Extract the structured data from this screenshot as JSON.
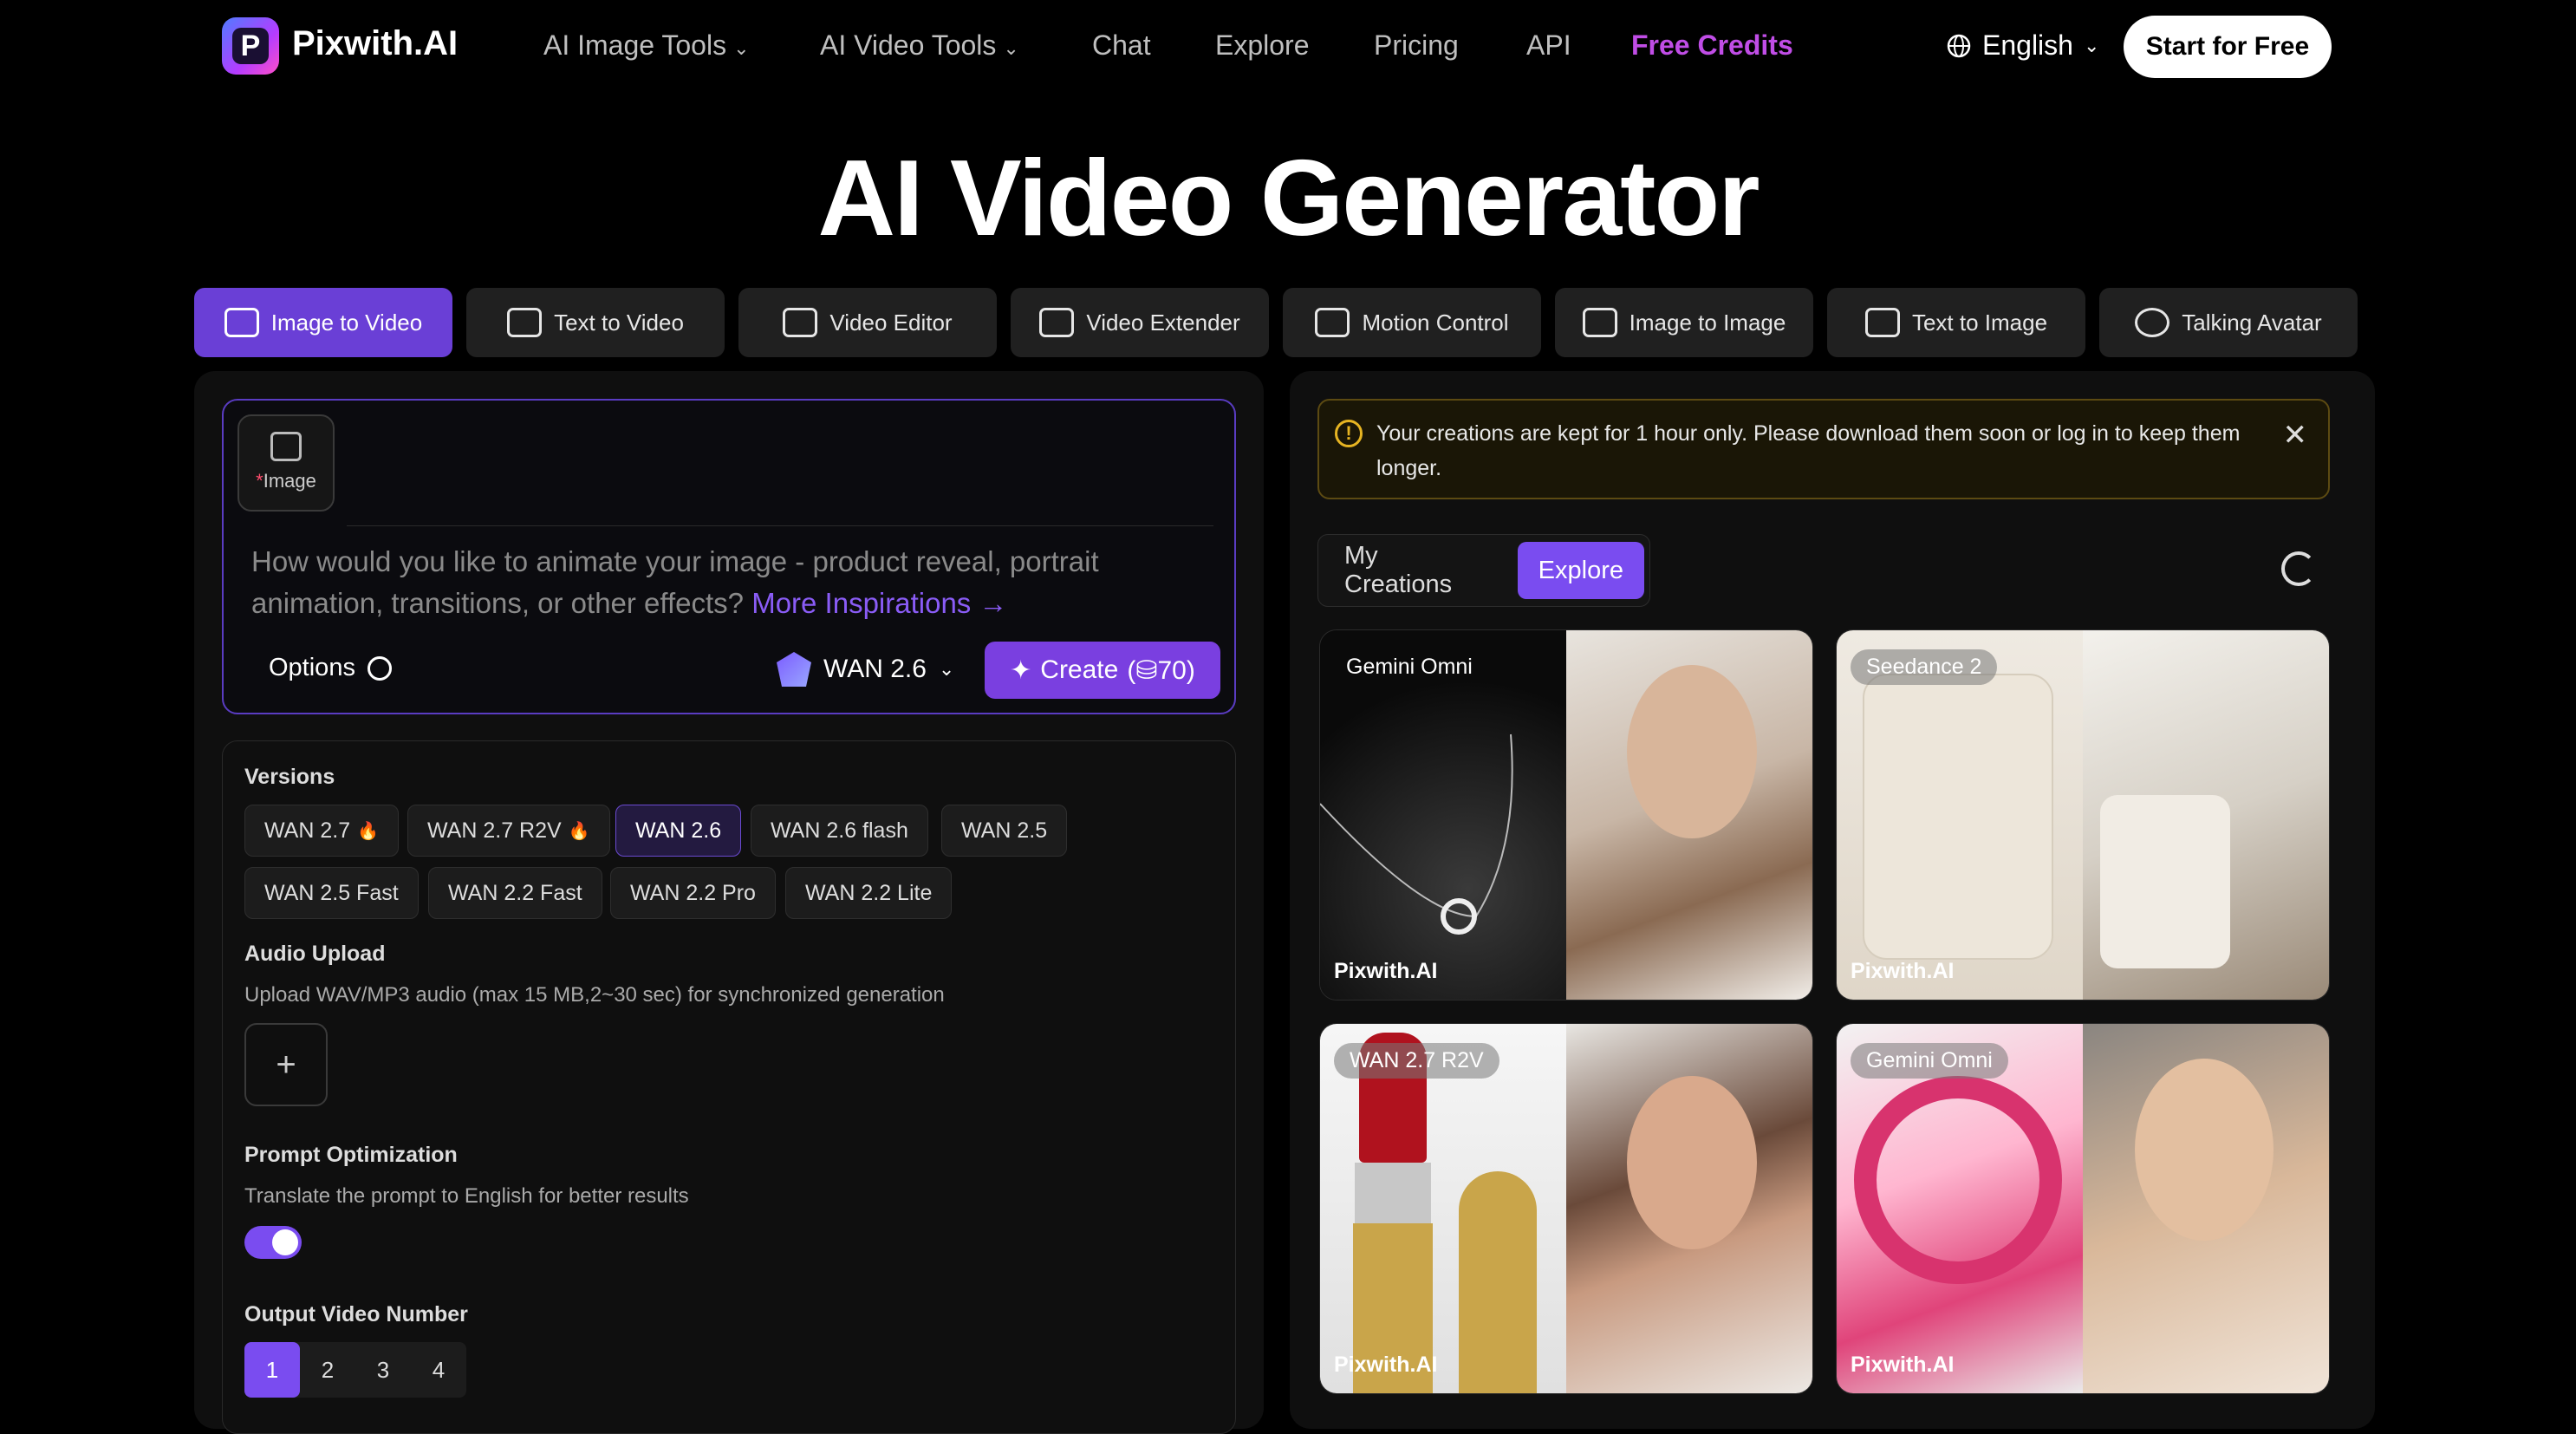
{
  "brand": {
    "logo_letter": "P",
    "name": "Pixwith.AI"
  },
  "nav": {
    "items": [
      "AI Image Tools",
      "AI Video Tools",
      "Chat",
      "Explore",
      "Pricing",
      "API",
      "Free Credits"
    ],
    "chevron": "⌄",
    "language": "English",
    "start_label": "Start for Free"
  },
  "hero": {
    "title": "AI Video Generator"
  },
  "tabs": [
    "Image to Video",
    "Text to Video",
    "Video Editor",
    "Video Extender",
    "Motion Control",
    "Image to Image",
    "Text to Image",
    "Talking Avatar"
  ],
  "prompt": {
    "image_label": "Image",
    "required_mark": "*",
    "placeholder": "How would you like to animate your image - product reveal, portrait animation, transitions, or other effects?",
    "inspirations_link": "More Inspirations →",
    "options_label": "Options",
    "model": "WAN 2.6",
    "create_label": "Create",
    "create_cost": "70"
  },
  "settings": {
    "versions_title": "Versions",
    "versions": [
      {
        "label": "WAN 2.7",
        "hot": true
      },
      {
        "label": "WAN 2.7 R2V",
        "hot": true
      },
      {
        "label": "WAN 2.6",
        "hot": false,
        "selected": true
      },
      {
        "label": "WAN 2.6 flash",
        "hot": false
      },
      {
        "label": "WAN 2.5",
        "hot": false
      },
      {
        "label": "WAN 2.5 Fast",
        "hot": false
      },
      {
        "label": "WAN 2.2 Fast",
        "hot": false
      },
      {
        "label": "WAN 2.2 Pro",
        "hot": false
      },
      {
        "label": "WAN 2.2 Lite",
        "hot": false
      }
    ],
    "audio_title": "Audio Upload",
    "audio_desc": "Upload WAV/MP3 audio (max 15 MB,2~30 sec) for synchronized generation",
    "opt_title": "Prompt Optimization",
    "opt_desc": "Translate the prompt to English for better results",
    "opt_enabled": true,
    "output_title": "Output Video Number",
    "output_numbers": [
      "1",
      "2",
      "3",
      "4"
    ],
    "output_selected": "1"
  },
  "notice": {
    "text": "Your creations are kept for 1 hour only. Please download them soon or log in to keep them longer."
  },
  "gallery": {
    "tabs": [
      "My Creations",
      "Explore"
    ],
    "active_tab": "Explore",
    "cards": [
      {
        "model": "Gemini Omni",
        "watermark": "Pixwith.AI"
      },
      {
        "model": "Seedance 2",
        "watermark": "Pixwith.AI"
      },
      {
        "model": "WAN 2.7 R2V",
        "watermark": "Pixwith.AI"
      },
      {
        "model": "Gemini Omni",
        "watermark": "Pixwith.AI"
      }
    ]
  },
  "colors": {
    "accent": "#7a4cf0",
    "free_credits": "#c04de6",
    "warning": "#e6b422"
  }
}
